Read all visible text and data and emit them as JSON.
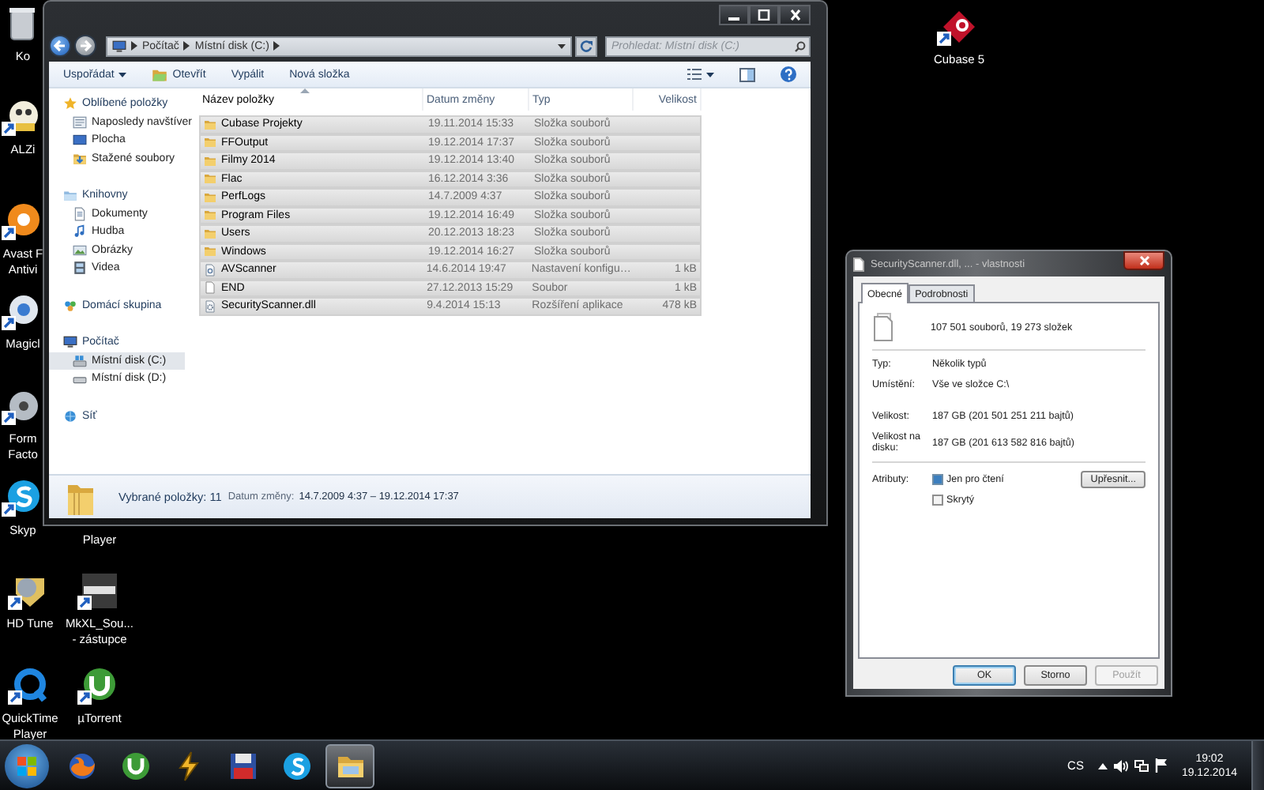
{
  "desktop_icons": [
    {
      "lines": [
        "Ko"
      ],
      "kind": "bin"
    },
    {
      "lines": [
        "ALZi"
      ],
      "kind": "alzip"
    },
    {
      "lines": [
        "Avast F",
        "Antivi"
      ],
      "kind": "avast"
    },
    {
      "lines": [
        "Magicl"
      ],
      "kind": "magic"
    },
    {
      "lines": [
        "Form",
        "Facto"
      ],
      "kind": "format"
    },
    {
      "lines": [
        "Skyp"
      ],
      "kind": "skype"
    },
    {
      "lines": [
        "HD Tune"
      ],
      "kind": "hdtune"
    },
    {
      "lines": [
        "QuickTime",
        "Player"
      ],
      "kind": "quicktime"
    },
    {
      "lines": [
        "Player"
      ],
      "kind": "covered"
    },
    {
      "lines": [
        "MkXL_Sou...",
        "- zástupce"
      ],
      "kind": "mkxl"
    },
    {
      "lines": [
        "µTorrent"
      ],
      "kind": "utorrent"
    },
    {
      "lines": [
        "Cubase 5"
      ],
      "kind": "cubase"
    }
  ],
  "explorer": {
    "breadcrumb": [
      "Počítač",
      "Místní disk (C:)"
    ],
    "search": {
      "placeholder": "Prohledat: Místní disk (C:)"
    },
    "toolbar": [
      {
        "label": "Uspořádat",
        "kind": "menu"
      },
      {
        "label": "Otevřít",
        "kind": "icon"
      },
      {
        "label": "Vypálit",
        "kind": "plain"
      },
      {
        "label": "Nová složka",
        "kind": "plain"
      }
    ],
    "nav": [
      {
        "label": "Oblíbené položky",
        "kind": "favorites",
        "selected": false,
        "children": [
          {
            "label": "Naposledy navštíver",
            "kind": "recent",
            "selected": false
          },
          {
            "label": "Plocha",
            "kind": "desktop",
            "selected": false
          },
          {
            "label": "Stažené soubory",
            "kind": "downloads",
            "selected": false
          }
        ]
      },
      {
        "label": "Knihovny",
        "kind": "libraries",
        "selected": false,
        "children": [
          {
            "label": "Dokumenty",
            "kind": "documents",
            "selected": false
          },
          {
            "label": "Hudba",
            "kind": "music",
            "selected": false
          },
          {
            "label": "Obrázky",
            "kind": "pictures",
            "selected": false
          },
          {
            "label": "Videa",
            "kind": "videos",
            "selected": false
          }
        ]
      },
      {
        "label": "Domácí skupina",
        "kind": "homegroup",
        "selected": false
      },
      {
        "label": "Počítač",
        "kind": "computer",
        "selected": false,
        "children": [
          {
            "label": "Místní disk (C:)",
            "kind": "system-drive",
            "selected": true
          },
          {
            "label": "Místní disk (D:)",
            "kind": "drive",
            "selected": false
          }
        ]
      },
      {
        "label": "Síť",
        "kind": "network",
        "selected": false
      }
    ],
    "columns": [
      {
        "label": "Název položky",
        "sorted": true
      },
      {
        "label": "Datum změny",
        "sorted": false
      },
      {
        "label": "Typ",
        "sorted": false
      },
      {
        "label": "Velikost",
        "sorted": false
      }
    ],
    "rows": [
      {
        "name": "Cubase Projekty",
        "date": "19.11.2014 15:33",
        "type": "Složka souborů",
        "size": "",
        "kind": "folder",
        "selected": true
      },
      {
        "name": "FFOutput",
        "date": "19.12.2014 17:37",
        "type": "Složka souborů",
        "size": "",
        "kind": "folder",
        "selected": true
      },
      {
        "name": "Filmy 2014",
        "date": "19.12.2014 13:40",
        "type": "Složka souborů",
        "size": "",
        "kind": "folder",
        "selected": true
      },
      {
        "name": "Flac",
        "date": "16.12.2014 3:36",
        "type": "Složka souborů",
        "size": "",
        "kind": "folder",
        "selected": true
      },
      {
        "name": "PerfLogs",
        "date": "14.7.2009 4:37",
        "type": "Složka souborů",
        "size": "",
        "kind": "folder",
        "selected": true
      },
      {
        "name": "Program Files",
        "date": "19.12.2014 16:49",
        "type": "Složka souborů",
        "size": "",
        "kind": "folder",
        "selected": true
      },
      {
        "name": "Users",
        "date": "20.12.2013 18:23",
        "type": "Složka souborů",
        "size": "",
        "kind": "folder",
        "selected": true
      },
      {
        "name": "Windows",
        "date": "19.12.2014 16:27",
        "type": "Složka souborů",
        "size": "",
        "kind": "folder",
        "selected": true
      },
      {
        "name": "AVScanner",
        "date": "14.6.2014 19:47",
        "type": "Nastavení konfigu…",
        "size": "1 kB",
        "kind": "config",
        "selected": true
      },
      {
        "name": "END",
        "date": "27.12.2013 15:29",
        "type": "Soubor",
        "size": "1 kB",
        "kind": "file",
        "selected": true
      },
      {
        "name": "SecurityScanner.dll",
        "date": "9.4.2014 15:13",
        "type": "Rozšíření aplikace",
        "size": "478 kB",
        "kind": "dll",
        "selected": true
      }
    ],
    "status": {
      "count": "Vybrané položky: 11",
      "date_label": "Datum změny:",
      "date_value": "14.7.2009 4:37 – 19.12.2014 17:37"
    }
  },
  "properties": {
    "title": "SecurityScanner.dll, ... - vlastnosti",
    "tabs": [
      {
        "label": "Obecné",
        "selected": true
      },
      {
        "label": "Podrobnosti",
        "selected": false
      }
    ],
    "summary": "107 501 souborů,  19 273 složek",
    "fields": [
      {
        "label": "Typ:",
        "value": "Několik typů"
      },
      {
        "label": "Umístění:",
        "value": "Vše ve složce C:\\"
      },
      {
        "label": "Velikost:",
        "value": "187 GB (201 501 251 211 bajtů)"
      },
      {
        "label": "Velikost na disku:",
        "value": "187 GB (201 613 582 816 bajtů)"
      }
    ],
    "attributes_label": "Atributy:",
    "attributes": [
      {
        "label": "Jen pro čtení",
        "checked": false,
        "indeterminate": true
      },
      {
        "label": "Skrytý",
        "checked": false,
        "indeterminate": false
      }
    ],
    "advanced_button": "Upřesnit...",
    "buttons": [
      {
        "label": "OK",
        "default": true,
        "disabled": false
      },
      {
        "label": "Storno",
        "default": false,
        "disabled": false
      },
      {
        "label": "Použít",
        "default": false,
        "disabled": true
      }
    ]
  },
  "taskbar": {
    "pinned": [
      {
        "kind": "firefox",
        "active": false
      },
      {
        "kind": "utorrent",
        "active": false
      },
      {
        "kind": "winamp",
        "active": false
      },
      {
        "kind": "save",
        "active": false
      },
      {
        "kind": "skype",
        "active": false
      },
      {
        "kind": "explorer",
        "active": true
      }
    ],
    "language": "CS",
    "time": "19:02",
    "date": "19.12.2014"
  }
}
